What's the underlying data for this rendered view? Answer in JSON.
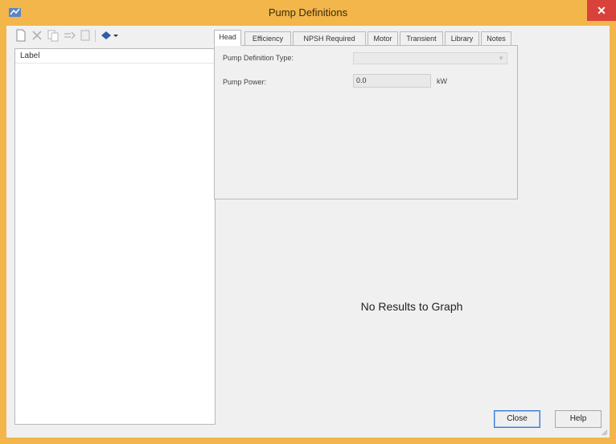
{
  "window": {
    "title": "Pump Definitions"
  },
  "list": {
    "header": "Label"
  },
  "tabs": [
    {
      "label": "Head",
      "active": true
    },
    {
      "label": "Efficiency",
      "active": false
    },
    {
      "label": "NPSH Required",
      "active": false
    },
    {
      "label": "Motor",
      "active": false
    },
    {
      "label": "Transient",
      "active": false
    },
    {
      "label": "Library",
      "active": false
    },
    {
      "label": "Notes",
      "active": false
    }
  ],
  "head": {
    "definition_type_label": "Pump Definition Type:",
    "definition_type_value": "",
    "power_label": "Pump Power:",
    "power_value": "0.0",
    "power_unit": "kW"
  },
  "graph": {
    "message": "No Results to Graph"
  },
  "buttons": {
    "close": "Close",
    "help": "Help"
  },
  "icons": {
    "toolbar": [
      "new-icon",
      "delete-icon",
      "copy-icon",
      "rename-icon",
      "report-icon",
      "synchronize-icon"
    ]
  },
  "colors": {
    "titlebar": "#f2b64a",
    "close": "#d9423a",
    "default_button_border": "#3a7bd5"
  }
}
